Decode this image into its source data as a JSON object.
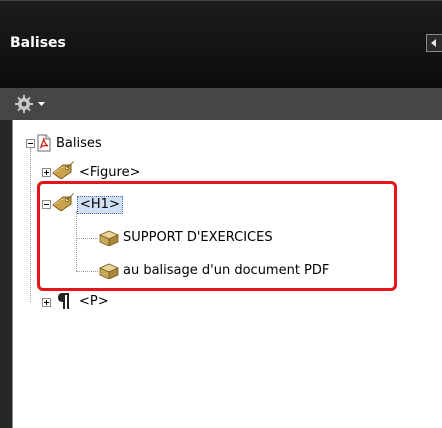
{
  "panel": {
    "title": "Balises"
  },
  "tree": {
    "root_label": "Balises",
    "nodes": [
      {
        "label": "<Figure>",
        "icon": "tag-icon",
        "expanded": false
      },
      {
        "label": "<H1>",
        "icon": "tag-icon",
        "expanded": true,
        "selected": true,
        "children": [
          {
            "label": "SUPPORT D'EXERCICES",
            "icon": "content-box-icon"
          },
          {
            "label": "au balisage d'un document PDF",
            "icon": "content-box-icon"
          }
        ]
      },
      {
        "label": "<P>",
        "icon": "paragraph-icon",
        "expanded": false
      }
    ]
  },
  "colors": {
    "highlight": "#e8141b",
    "selection": "#cfe0f5"
  }
}
